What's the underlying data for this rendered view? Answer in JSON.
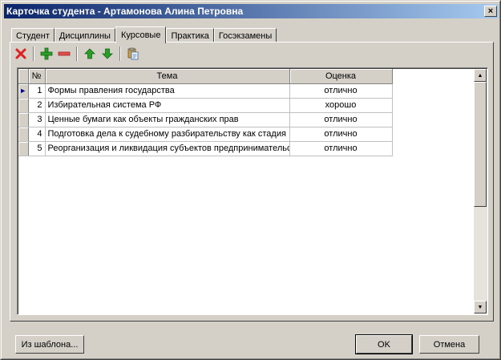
{
  "window": {
    "title": "Карточка студента - Артамонова Алина Петровна",
    "close_glyph": "×"
  },
  "tabs": [
    {
      "label": "Студент",
      "active": false
    },
    {
      "label": "Дисциплины",
      "active": false
    },
    {
      "label": "Курсовые",
      "active": true
    },
    {
      "label": "Практика",
      "active": false
    },
    {
      "label": "Госэкзамены",
      "active": false
    }
  ],
  "toolbar": {
    "icons": [
      "delete-icon",
      "add-icon",
      "remove-icon",
      "move-up-icon",
      "move-down-icon",
      "paste-icon"
    ],
    "colors": {
      "delete": "#e02020",
      "add": "#2aa02a",
      "remove": "#e05050",
      "arrows": "#28a028"
    }
  },
  "grid": {
    "headers": {
      "num": "№",
      "topic": "Тема",
      "grade": "Оценка"
    },
    "rows": [
      {
        "num": "1",
        "topic": "Формы правления государства",
        "grade": "отлично"
      },
      {
        "num": "2",
        "topic": "Избирательная система  РФ",
        "grade": "хорошо"
      },
      {
        "num": "3",
        "topic": "Ценные бумаги как объекты  гражданских прав",
        "grade": "отлично"
      },
      {
        "num": "4",
        "topic": "Подготовка  дела к судебному разбирательству  как стадия",
        "grade": "отлично"
      },
      {
        "num": "5",
        "topic": "Реорганизация и ликвидация субъектов предпринимательской деятельности",
        "grade": "отлично"
      }
    ],
    "current_row_marker": "►"
  },
  "scrollbar": {
    "up_glyph": "▲",
    "down_glyph": "▼"
  },
  "buttons": {
    "template": "Из шаблона...",
    "ok": "OK",
    "cancel": "Отмена"
  }
}
